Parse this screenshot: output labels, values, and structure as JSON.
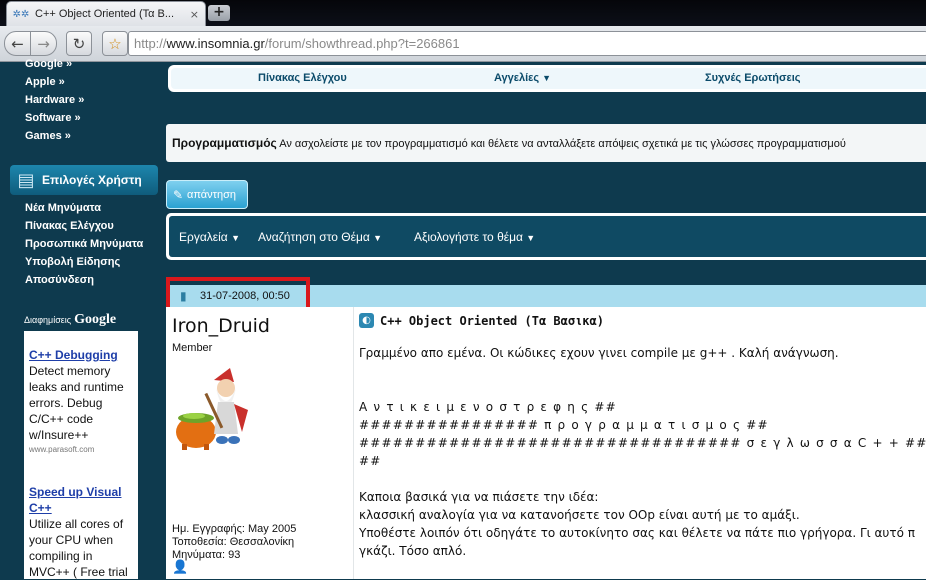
{
  "browser": {
    "tab_title": "C++ Object Oriented (Τα Β...",
    "tab_close": "×",
    "new_tab": "+",
    "url_prefix": "http://",
    "url_host": "www.insomnia.gr",
    "url_path": "/forum/showthread.php?t=266861"
  },
  "sidebar": {
    "top_links": [
      "Google »",
      "Apple »",
      "Hardware »",
      "Software »",
      "Games »"
    ],
    "user_panel_title": "Επιλογές Χρήστη",
    "user_links": [
      "Νέα Μηνύματα",
      "Πίνακας Ελέγχου",
      "Προσωπικά Μηνύματα",
      "Υποβολή Είδησης",
      "Αποσύνδεση"
    ],
    "ads_label": "Διαφημίσεις",
    "ads_brand": "Google",
    "ads": [
      {
        "title": "C++ Debugging",
        "body": [
          "Detect memory",
          "leaks and runtime",
          "errors. Debug",
          "C/C++ code",
          "w/Insure++"
        ],
        "url": "www.parasoft.com"
      },
      {
        "title_lines": [
          "Speed up Visual",
          "C++"
        ],
        "body": [
          "Utilize all cores of",
          "your CPU when",
          "compiling in",
          "MVC++ ( Free trial"
        ]
      }
    ]
  },
  "topnav": {
    "items": [
      "Πίνακας Ελέγχου",
      "Αγγελίες",
      "Συχνές Ερωτήσεις"
    ]
  },
  "forum": {
    "name": "Προγραμματισμός",
    "description": "Αν ασχολείστε με τον προγραμματισμό και θέλετε να ανταλλάξετε απόψεις σχετικά με τις γλώσσες προγραμματισμού"
  },
  "reply_button": "απάντηση",
  "thread_tools": [
    "Εργαλεία",
    "Αναζήτηση στο Θέμα",
    "Αξιολογήστε το θέμα"
  ],
  "post": {
    "date": "31-07-2008, 00:50",
    "username": "Iron_Druid",
    "user_title": "Member",
    "join_date": "Ημ. Εγγραφής: May 2005",
    "location": "Τοποθεσία: Θεσσαλονίκη",
    "posts": "Μηνύματα: 93",
    "title": "C++ Object Oriented (Τα Βασικα)",
    "lines": [
      "Γραμμένο απο εμένα. Οι κώδικες εχουν γινει compile με g++ . Καλή ανάγνωση.",
      "Α ν τ ι κ ε ι μ ε ν ο σ τ ρ ε φ η ς ##",
      "################ π ρ ο γ ρ α μ μ α τ ι σ μ ο ς ##",
      "################################## σ ε γ λ ω σ σ α C + + ##",
      "##",
      "Καποια βασικά για να πιάσετε την ιδέα:",
      "κλασσική αναλογία για να κατανοήσετε τον OOp είναι αυτή με το αμάξι.",
      "Υποθέστε λοιπόν ότι οδηγάτε το αυτοκίνητο σας και θέλετε να πάτε πιο γρήγορα. Γι αυτό π",
      "γκάζι. Τόσο απλό."
    ]
  },
  "colors": {
    "page_bg": "#0e3a4e",
    "accent": "#2aa1d1",
    "highlight_box": "#d9181c",
    "post_header": "#a8dcee"
  }
}
